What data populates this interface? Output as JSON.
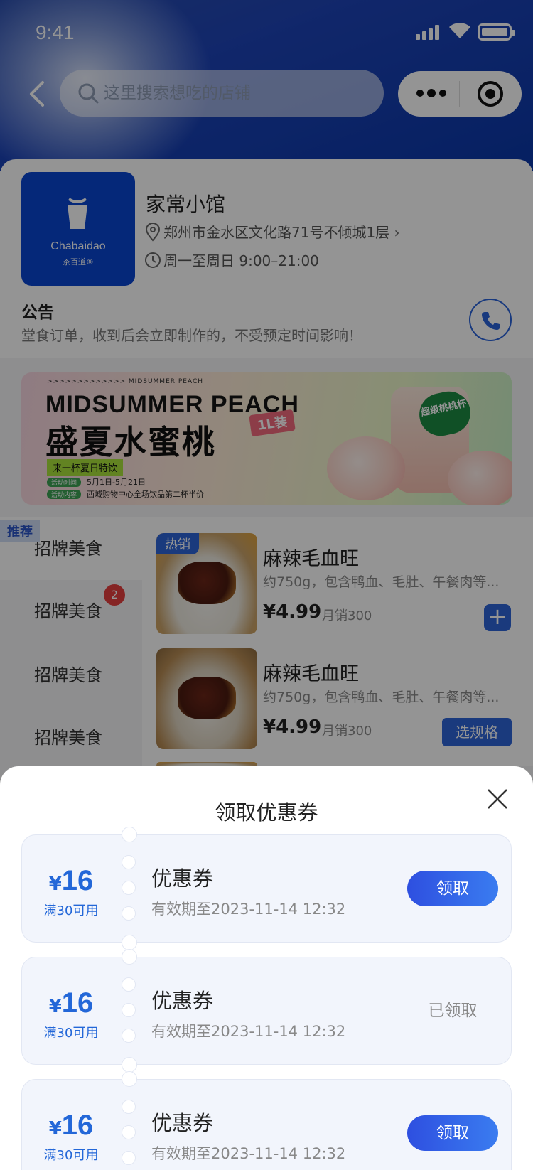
{
  "status_bar": {
    "time": "9:41"
  },
  "search": {
    "placeholder": "这里搜索想吃的店铺"
  },
  "store": {
    "logo_name": "Chabaidao",
    "logo_sub": "茶百道®",
    "name": "家常小馆",
    "address": "郑州市金水区文化路71号不倾城1层",
    "hours": "周一至周日 9:00–21:00",
    "notice_title": "公告",
    "notice_text": "堂食订单，收到后会立即制作的，不受预定时间影响！"
  },
  "banner": {
    "top_text": ">>>>>>>>>>>>>   MIDSUMMER PEACH",
    "title_en": "MIDSUMMER PEACH",
    "title_zh": "盛夏水蜜桃",
    "tag": "1L装",
    "subtitle": "来一杯夏日特饮",
    "row1_label": "活动时间",
    "row1_text": "5月1日-5月21日",
    "row2_label": "活动内容",
    "row2_text": "西城购物中心全场饮品第二杯半价",
    "badge": "超级桃桃杯",
    "bottom_text": "MIDSUMMER PEACH"
  },
  "categories": {
    "recommend_tag": "推荐",
    "items": [
      {
        "label": "招牌美食"
      },
      {
        "label": "招牌美食",
        "badge": "2"
      },
      {
        "label": "招牌美食"
      },
      {
        "label": "招牌美食"
      }
    ]
  },
  "products": [
    {
      "tag": "热销",
      "name": "麻辣毛血旺",
      "desc": "约750g，包含鸭血、毛肚、午餐肉等...",
      "price": "¥4.99",
      "sales": "月销300",
      "action": "+"
    },
    {
      "name": "麻辣毛血旺",
      "desc": "约750g，包含鸭血、毛肚、午餐肉等...",
      "price": "¥4.99",
      "sales": "月销300",
      "action": "选规格"
    }
  ],
  "sheet": {
    "title": "领取优惠券",
    "coupons": [
      {
        "symbol": "¥",
        "amount": "16",
        "condition": "满30可用",
        "name": "优惠券",
        "expiry": "有效期至2023-11-14  12:32",
        "action": "领取",
        "claimed": false
      },
      {
        "symbol": "¥",
        "amount": "16",
        "condition": "满30可用",
        "name": "优惠券",
        "expiry": "有效期至2023-11-14  12:32",
        "action": "已领取",
        "claimed": true
      },
      {
        "symbol": "¥",
        "amount": "16",
        "condition": "满30可用",
        "name": "优惠券",
        "expiry": "有效期至2023-11-14  12:32",
        "action": "领取",
        "claimed": false
      }
    ]
  },
  "colors": {
    "accent": "#2d64d8",
    "coupon_blue": "#2367d8",
    "badge_red": "#e53e3e"
  }
}
